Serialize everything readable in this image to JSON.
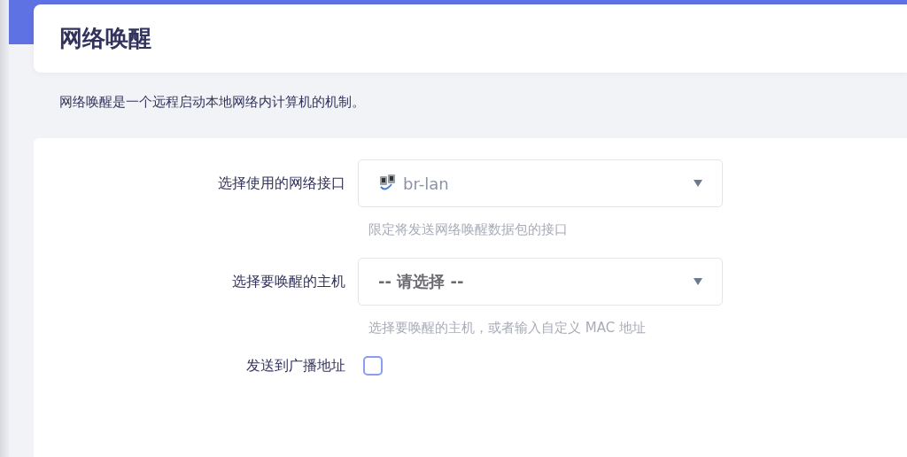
{
  "title": "网络唤醒",
  "description": "网络唤醒是一个远程启动本地网络内计算机的机制。",
  "fields": [
    {
      "kind": "select",
      "label": "选择使用的网络接口",
      "value": "br-lan",
      "hint": "限定将发送网络唤醒数据包的接口"
    },
    {
      "kind": "select",
      "label": "选择要唤醒的主机",
      "placeholder": "-- 请选择 --",
      "hint": "选择要唤醒的主机，或者输入自定义 MAC 地址"
    },
    {
      "kind": "checkbox",
      "label": "发送到广播地址",
      "checked": false
    }
  ]
}
